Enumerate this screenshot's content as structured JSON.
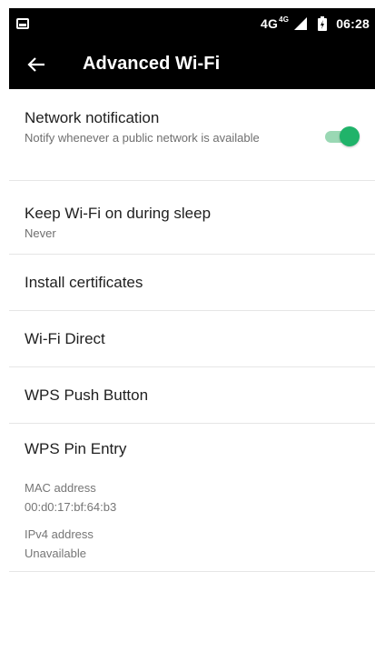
{
  "status_bar": {
    "network_label": "4G",
    "network_sup": "4G",
    "time": "06:28"
  },
  "app_bar": {
    "title": "Advanced Wi-Fi"
  },
  "settings": {
    "network_notification": {
      "title": "Network notification",
      "subtitle": "Notify whenever a public network is available",
      "enabled": true
    },
    "keep_wifi": {
      "title": "Keep Wi-Fi on during sleep",
      "subtitle": "Never"
    },
    "install_certificates": {
      "title": "Install certificates"
    },
    "wifi_direct": {
      "title": "Wi-Fi Direct"
    },
    "wps_push": {
      "title": "WPS Push Button"
    },
    "wps_pin": {
      "title": "WPS Pin Entry"
    }
  },
  "info": {
    "mac_label": "MAC address",
    "mac_value": "00:d0:17:bf:64:b3",
    "ipv4_label": "IPv4 address",
    "ipv4_value": "Unavailable"
  },
  "colors": {
    "toolbar_bg": "#000000",
    "accent": "#20b36a",
    "accent_track": "#9ad8b4",
    "divider": "#e6e6e6"
  },
  "icons": {
    "status_left": "notification-image-icon",
    "signal": "signal-icon",
    "battery": "battery-icon",
    "back": "arrow-back-icon"
  }
}
